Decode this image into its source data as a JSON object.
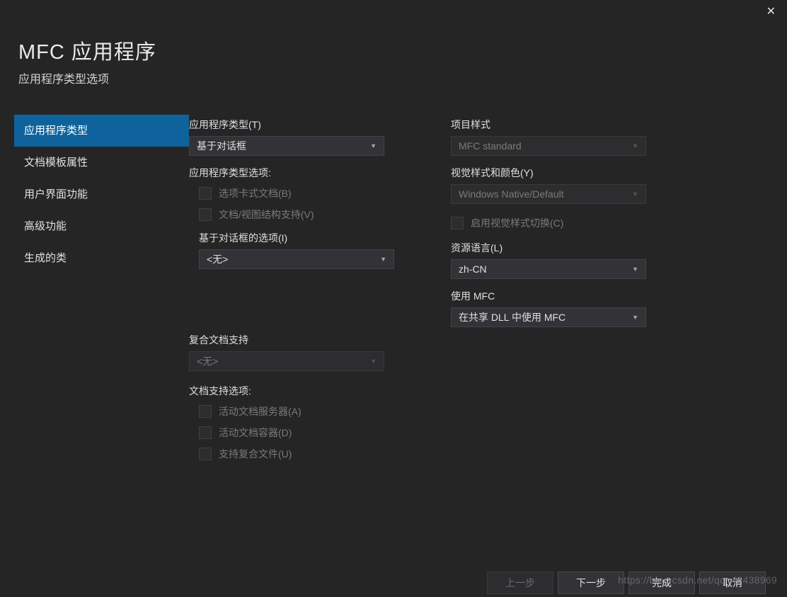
{
  "header": {
    "title": "MFC 应用程序",
    "subtitle": "应用程序类型选项"
  },
  "sidebar": {
    "items": [
      {
        "label": "应用程序类型",
        "selected": true
      },
      {
        "label": "文档模板属性",
        "selected": false
      },
      {
        "label": "用户界面功能",
        "selected": false
      },
      {
        "label": "高级功能",
        "selected": false
      },
      {
        "label": "生成的类",
        "selected": false
      }
    ]
  },
  "left": {
    "app_type_label": "应用程序类型(T)",
    "app_type_value": "基于对话框",
    "app_type_options_label": "应用程序类型选项:",
    "cb_tabbed": "选项卡式文档(B)",
    "cb_docview": "文档/视图结构支持(V)",
    "dialog_options_label": "基于对话框的选项(I)",
    "dialog_options_value": "<无>",
    "compound_label": "复合文档支持",
    "compound_value": "<无>",
    "doc_support_label": "文档支持选项:",
    "cb_active_server": "活动文档服务器(A)",
    "cb_active_container": "活动文档容器(D)",
    "cb_compound_files": "支持复合文件(U)"
  },
  "right": {
    "project_style_label": "项目样式",
    "project_style_value": "MFC standard",
    "visual_style_label": "视觉样式和颜色(Y)",
    "visual_style_value": "Windows Native/Default",
    "cb_visual_switch": "启用视觉样式切换(C)",
    "resource_lang_label": "资源语言(L)",
    "resource_lang_value": "zh-CN",
    "use_mfc_label": "使用 MFC",
    "use_mfc_value": "在共享 DLL 中使用 MFC"
  },
  "footer": {
    "prev": "上一步",
    "next": "下一步",
    "finish": "完成",
    "cancel": "取消"
  },
  "watermark": "https://blog.csdn.net/qq_42438969"
}
